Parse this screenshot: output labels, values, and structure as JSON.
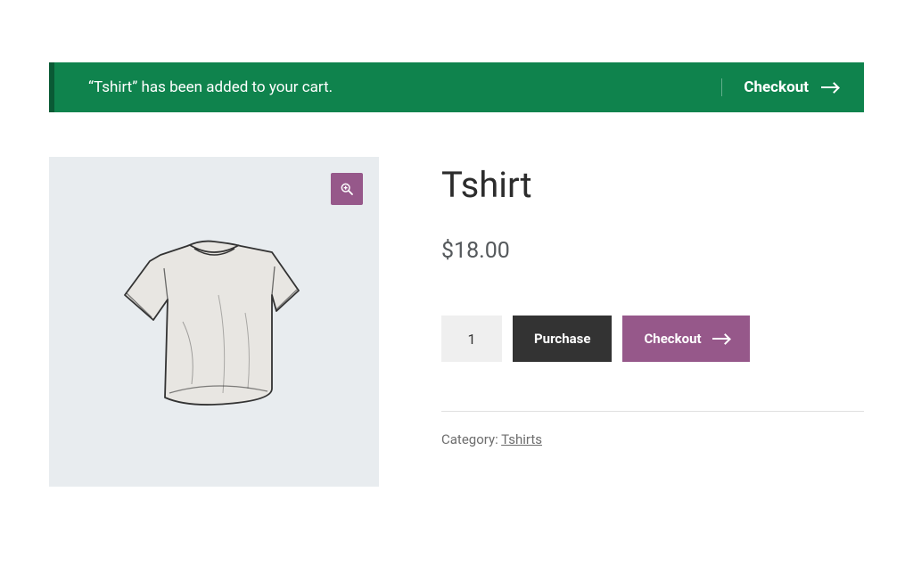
{
  "notice": {
    "message": "“Tshirt” has been added to your cart.",
    "checkout_label": "Checkout"
  },
  "product": {
    "title": "Tshirt",
    "price": "$18.00",
    "quantity": "1",
    "purchase_label": "Purchase",
    "checkout_label": "Checkout"
  },
  "meta": {
    "category_label": "Category: ",
    "category_value": "Tshirts"
  },
  "colors": {
    "green": "#0f834d",
    "purple": "#96588a",
    "dark": "#333333"
  }
}
